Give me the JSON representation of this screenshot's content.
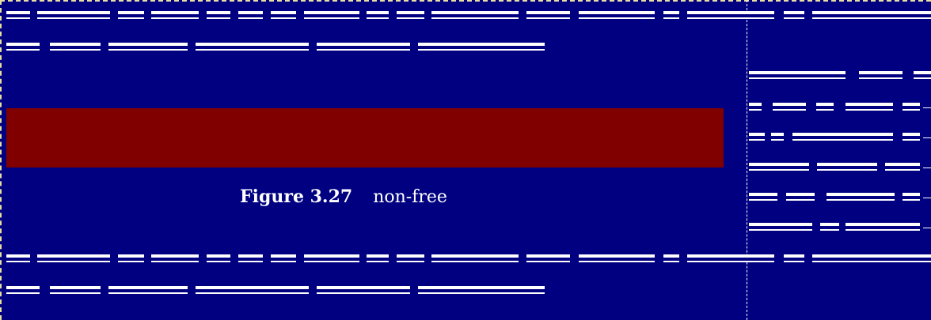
{
  "figure": {
    "label": "Figure 3.27",
    "caption": "non-free"
  },
  "colors": {
    "background": "#000080",
    "figure_fill": "#800000",
    "text": "#ffffff",
    "frame": "#e8e0a0"
  }
}
